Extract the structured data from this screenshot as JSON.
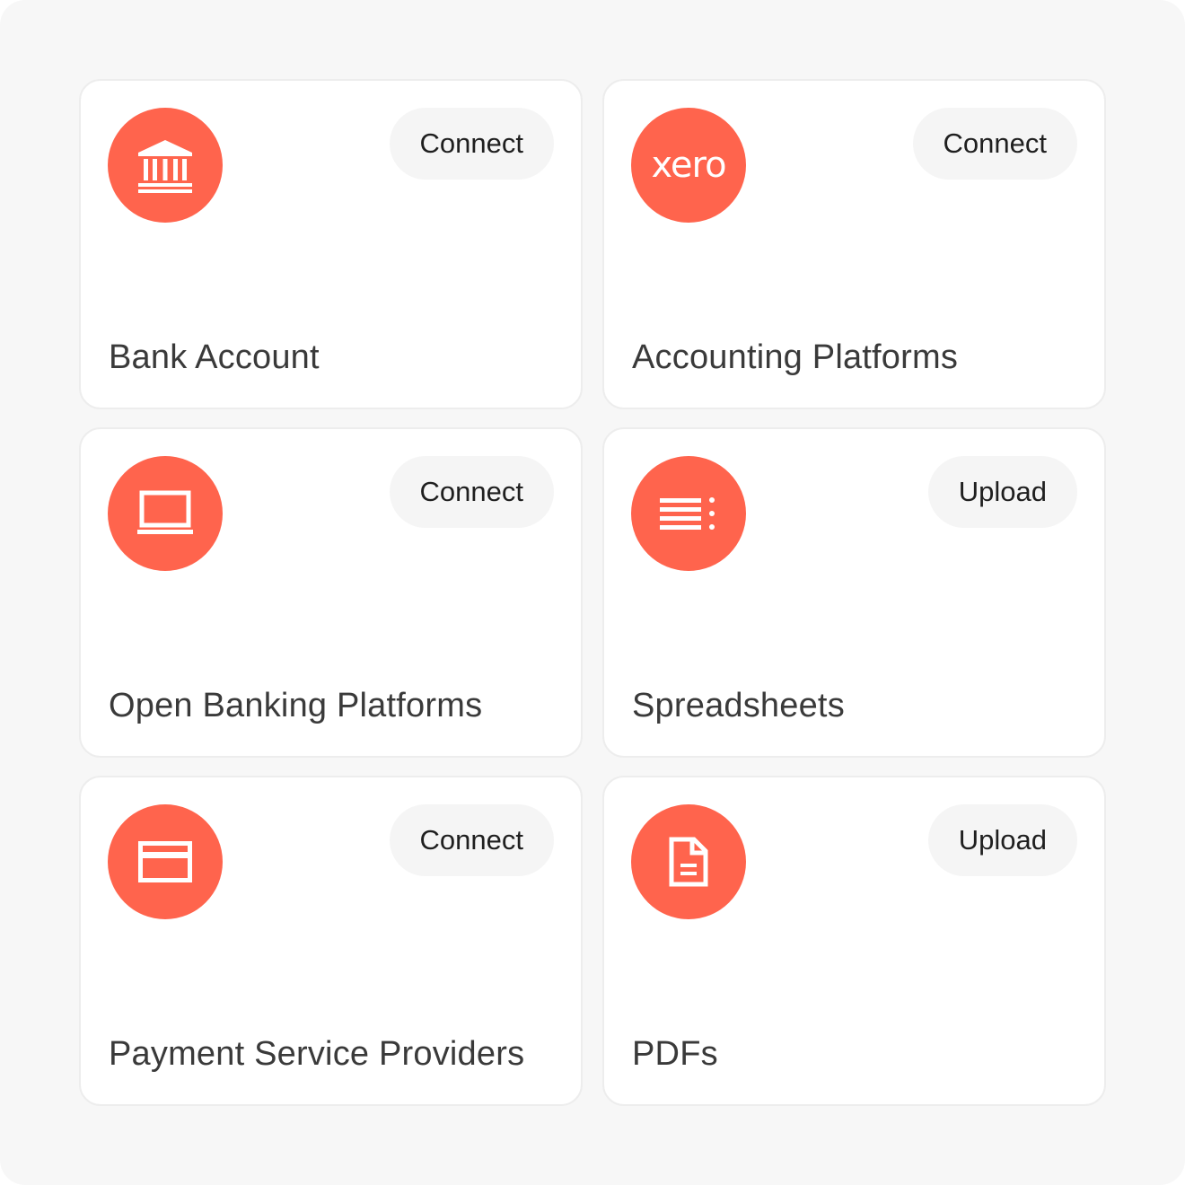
{
  "cards": [
    {
      "title": "Bank Account",
      "action": "Connect",
      "icon": "bank-icon"
    },
    {
      "title": "Accounting Platforms",
      "action": "Connect",
      "icon": "xero-logo",
      "logo_text": "xero"
    },
    {
      "title": "Open Banking Platforms",
      "action": "Connect",
      "icon": "laptop-icon"
    },
    {
      "title": "Spreadsheets",
      "action": "Upload",
      "icon": "list-icon"
    },
    {
      "title": "Payment Service Providers",
      "action": "Connect",
      "icon": "credit-card-icon"
    },
    {
      "title": "PDFs",
      "action": "Upload",
      "icon": "document-icon"
    }
  ],
  "colors": {
    "accent": "#ff644d",
    "page_background": "#f7f7f7",
    "card_background": "#ffffff",
    "button_background": "#f5f5f5"
  }
}
